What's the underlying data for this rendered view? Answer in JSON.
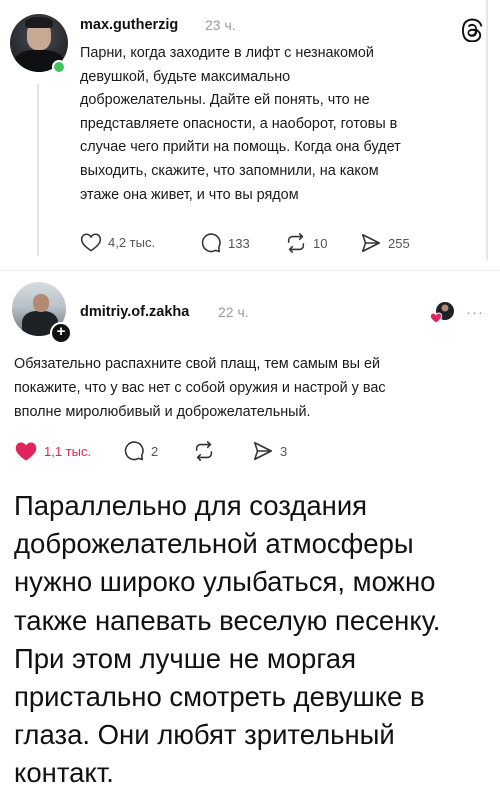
{
  "post1": {
    "username": "max.gutherzig",
    "time": "23 ч.",
    "lines": [
      "Парни, когда заходите в лифт с незнакомой",
      "девушкой, будьте максимально",
      "доброжелательны. Дайте ей понять, что не",
      "представляете опасности, а наоборот, готовы в",
      "случае чего прийти на помощь. Когда она будет",
      "выходить, скажите, что запомнили, на каком",
      "этаже она живет, и что вы рядом"
    ],
    "likes": "4,2 тыс.",
    "comments": "133",
    "reposts": "10",
    "shares": "255"
  },
  "post2": {
    "username": "dmitriy.of.zakha",
    "time": "22 ч.",
    "lines": [
      "Обязательно распахните свой плащ, тем самым вы ей",
      "покажите, что у вас нет с собой оружия и настрой у вас",
      "вполне миролюбивый и доброжелательный."
    ],
    "likes": "1,1 тыс.",
    "comments": "2",
    "shares": "3",
    "more": "···"
  },
  "caption": {
    "lines": [
      "Параллельно для создания",
      "доброжелательной атмосферы",
      "нужно широко улыбаться, можно",
      "также напевать веселую песенку.",
      "При этом лучше не моргая",
      "пристально смотреть девушке в",
      "глаза. Они любят зрительный",
      "контакт."
    ]
  },
  "colors": {
    "liked": "#e0245e",
    "online": "#3ec45a",
    "muted": "#9a9a9a"
  },
  "icons": [
    "threads-icon",
    "heart-icon",
    "comment-icon",
    "repost-icon",
    "share-icon",
    "plus-icon",
    "more-icon"
  ]
}
